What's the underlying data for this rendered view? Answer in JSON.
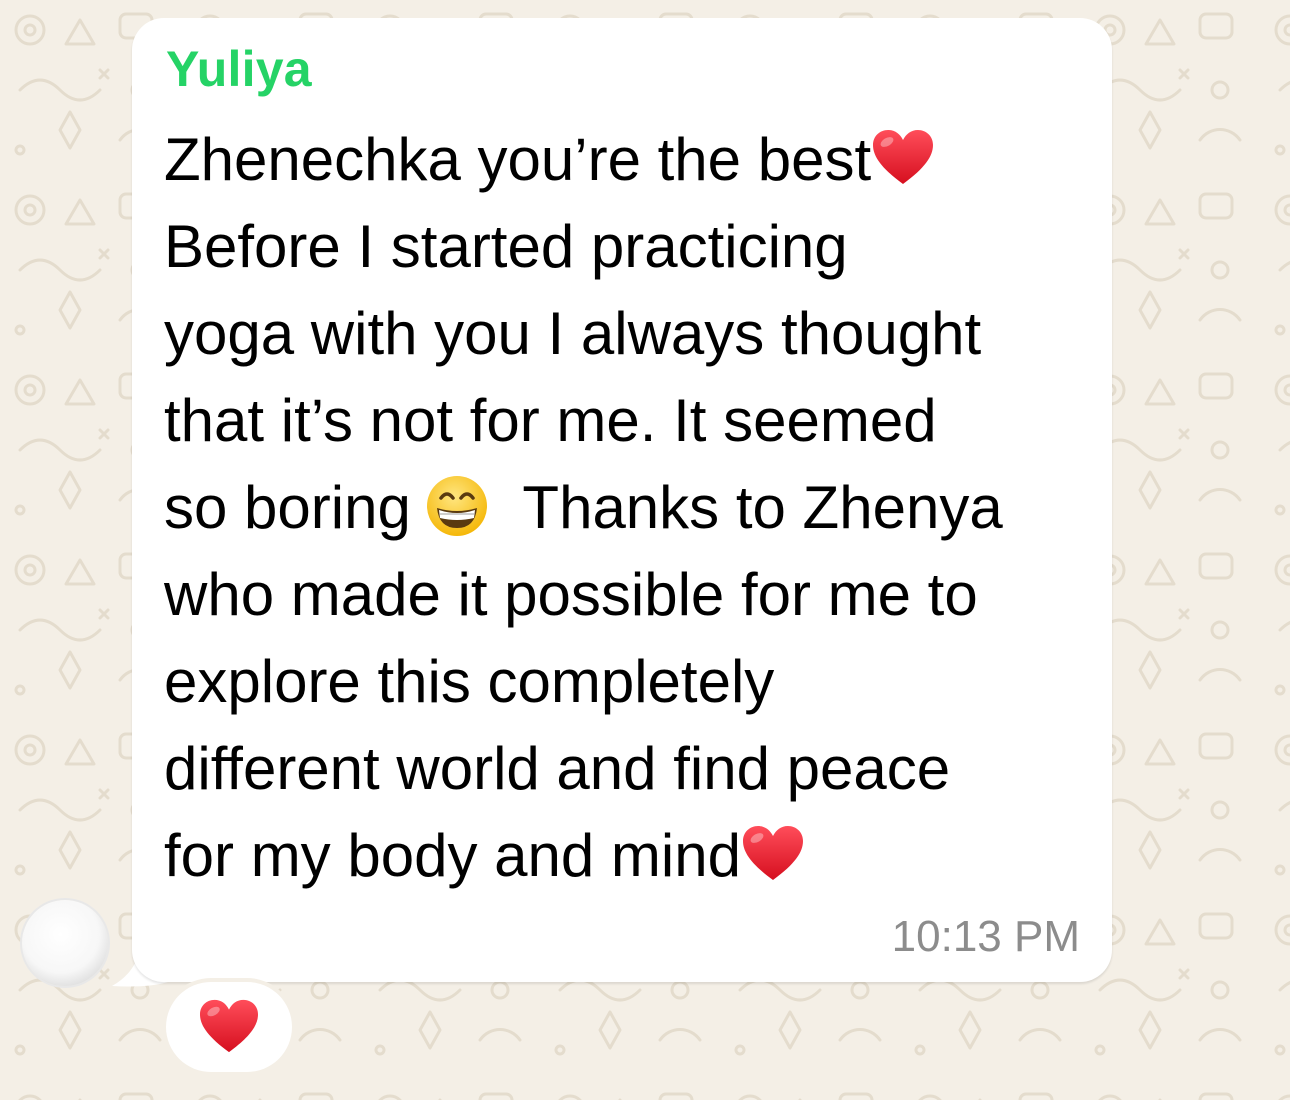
{
  "chat": {
    "background_color": "#f4efe6"
  },
  "message": {
    "sender": "Yuliya",
    "sender_color": "#25d366",
    "lines": {
      "l1": "Zhenechka you’re the best",
      "l2": "Before I started practicing",
      "l3": "yoga with you I always thought",
      "l4": "that it’s not for me. It seemed",
      "l5a": "so boring",
      "l5b": "Thanks to Zhenya",
      "l6": "who made it possible for me to",
      "l7": "explore this completely",
      "l8": "different world and find peace",
      "l9": "for my body and mind"
    },
    "timestamp": "10:13 PM",
    "emoji_icons": [
      "red-heart-icon",
      "grinning-face-icon",
      "red-heart-icon"
    ]
  },
  "reaction": {
    "icon": "red-heart-icon",
    "color": "#e0212e"
  }
}
